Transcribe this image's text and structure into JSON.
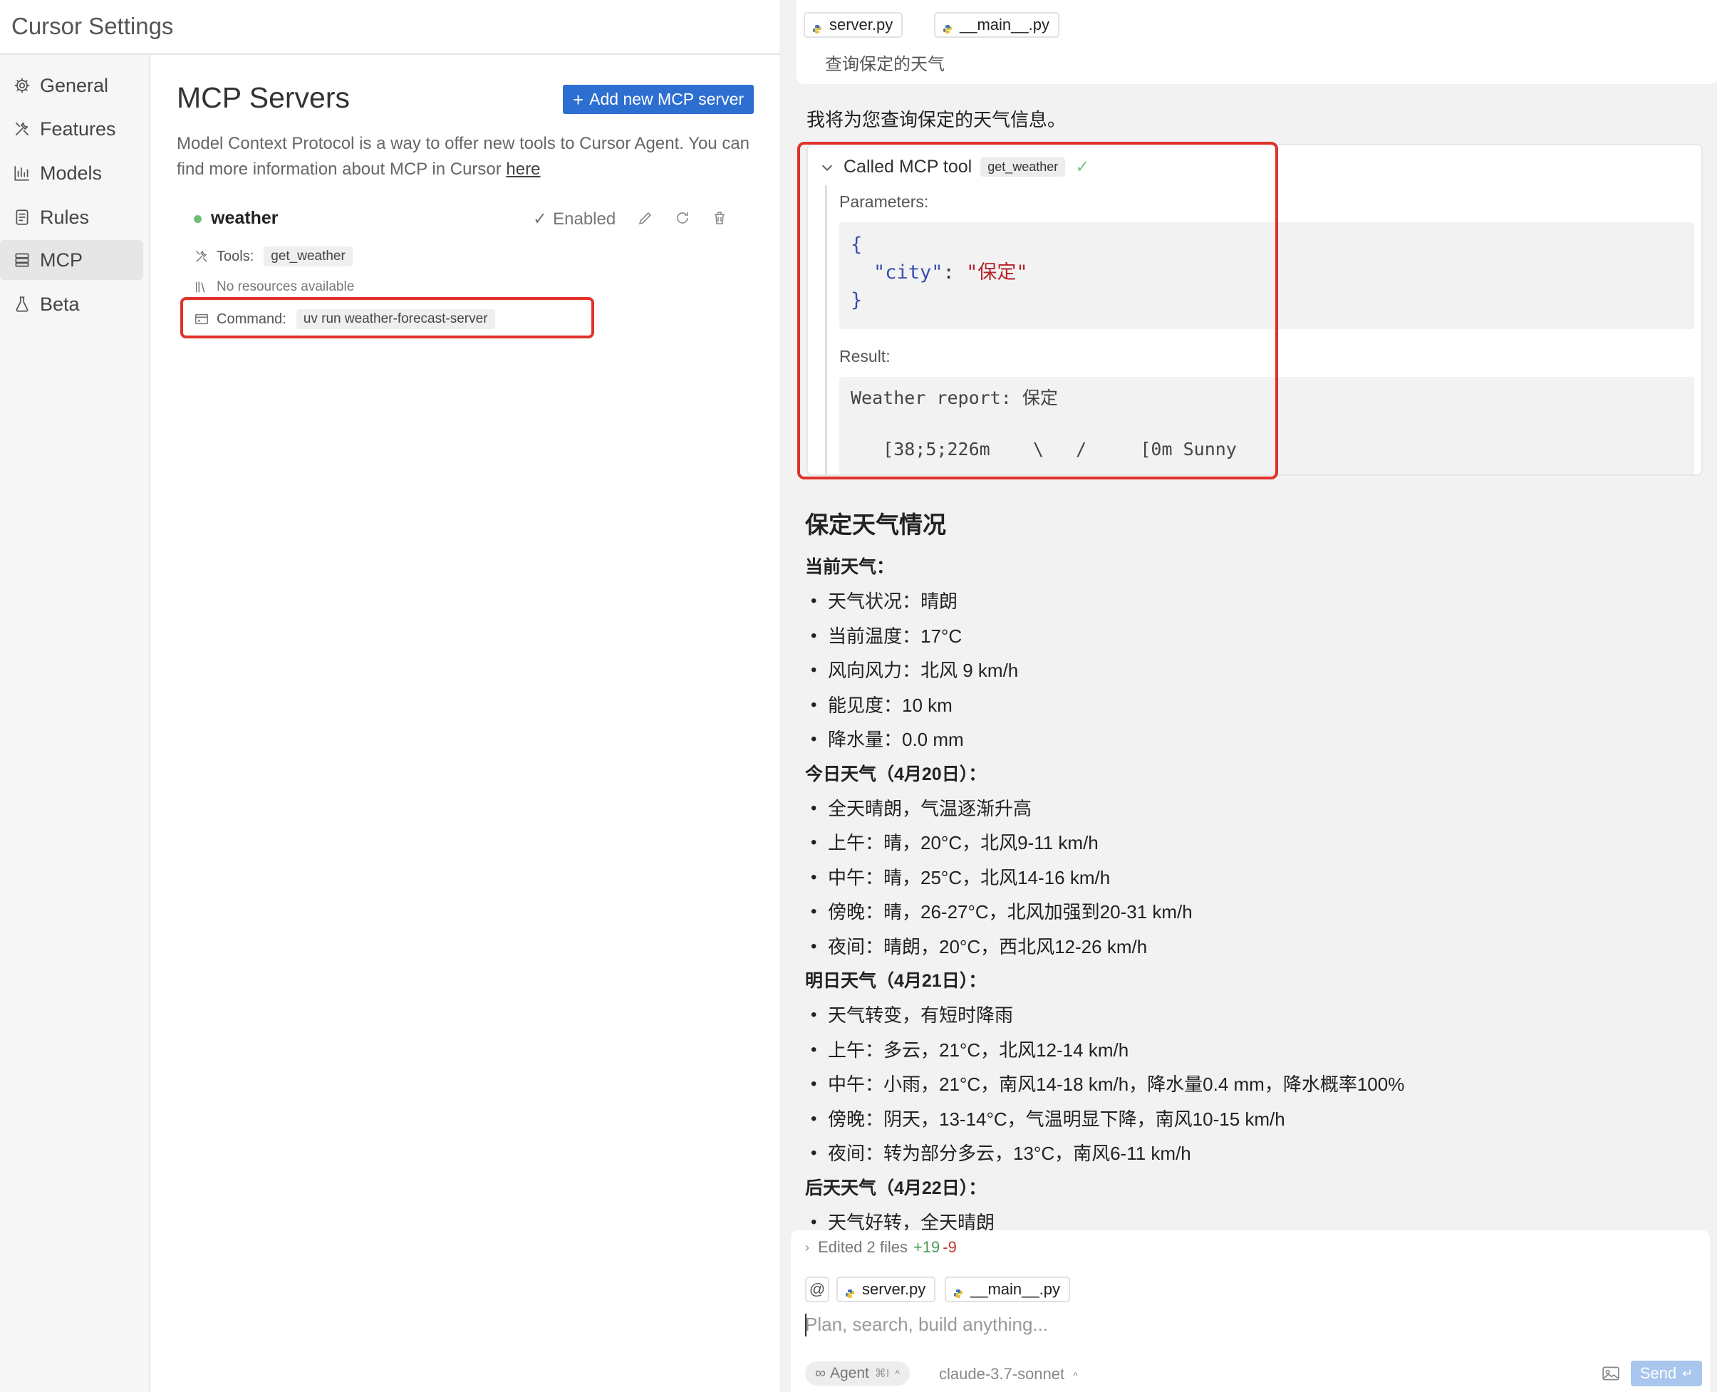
{
  "settings": {
    "title": "Cursor Settings",
    "sidebar": [
      {
        "label": "General",
        "icon": "gear-icon"
      },
      {
        "label": "Features",
        "icon": "tools-icon"
      },
      {
        "label": "Models",
        "icon": "bar-chart-icon"
      },
      {
        "label": "Rules",
        "icon": "document-icon"
      },
      {
        "label": "MCP",
        "icon": "server-icon",
        "active": true
      },
      {
        "label": "Beta",
        "icon": "flask-icon"
      }
    ],
    "mcp": {
      "title": "MCP Servers",
      "add_button": "Add new MCP server",
      "description": "Model Context Protocol is a way to offer new tools to Cursor Agent. You can find more information about MCP in Cursor ",
      "link_text": "here",
      "server": {
        "name": "weather",
        "status_color": "#6dbf73",
        "enabled_label": "Enabled",
        "tools_label": "Tools:",
        "tool": "get_weather",
        "resources": "No resources available",
        "command_label": "Command:",
        "command": "uv run weather-forecast-server"
      }
    }
  },
  "chat": {
    "files": [
      "server.py",
      "__main__.py"
    ],
    "user_query": "查询保定的天气",
    "reply_intro": "我将为您查询保定的天气信息。",
    "tool_call": {
      "header": "Called MCP tool",
      "tool": "get_weather",
      "check": "✓",
      "params_label": "Parameters:",
      "params_open": "{",
      "param_key": "\"city\"",
      "param_colon": ": ",
      "param_value": "\"保定\"",
      "params_close": "}",
      "result_label": "Result:",
      "result_line1": "Weather report: 保定",
      "result_line2": "   [38;5;226m    \\   /     [0m Sunny"
    },
    "report": {
      "title": "保定天气情况",
      "sections": [
        {
          "heading": "当前天气：",
          "items": [
            "天气状况：晴朗",
            "当前温度：17°C",
            "风向风力：北风 9 km/h",
            "能见度：10 km",
            "降水量：0.0 mm"
          ]
        },
        {
          "heading": "今日天气（4月20日）：",
          "items": [
            "全天晴朗，气温逐渐升高",
            "上午：晴，20°C，北风9-11 km/h",
            "中午：晴，25°C，北风14-16 km/h",
            "傍晚：晴，26-27°C，北风加强到20-31 km/h",
            "夜间：晴朗，20°C，西北风12-26 km/h"
          ]
        },
        {
          "heading": "明日天气（4月21日）：",
          "items": [
            "天气转变，有短时降雨",
            "上午：多云，21°C，北风12-14 km/h",
            "中午：小雨，21°C，南风14-18 km/h，降水量0.4 mm，降水概率100%",
            "傍晚：阴天，13-14°C，气温明显下降，南风10-15 km/h",
            "夜间：转为部分多云，13°C，南风6-11 km/h"
          ]
        },
        {
          "heading": "后天天气（4月22日）：",
          "items": [
            "天气好转，全天晴朗"
          ]
        }
      ]
    },
    "edited": {
      "label": "Edited 2 files",
      "plus": "+19",
      "minus": "-9"
    },
    "composer": {
      "at": "@",
      "placeholder": "Plan, search, build anything...",
      "agent_label": "Agent",
      "agent_shortcut": "⌘I",
      "model": "claude-3.7-sonnet",
      "send": "Send"
    }
  },
  "colors": {
    "accent": "#2d6fd0",
    "highlight": "#e0322b",
    "success": "#6dbf73"
  }
}
